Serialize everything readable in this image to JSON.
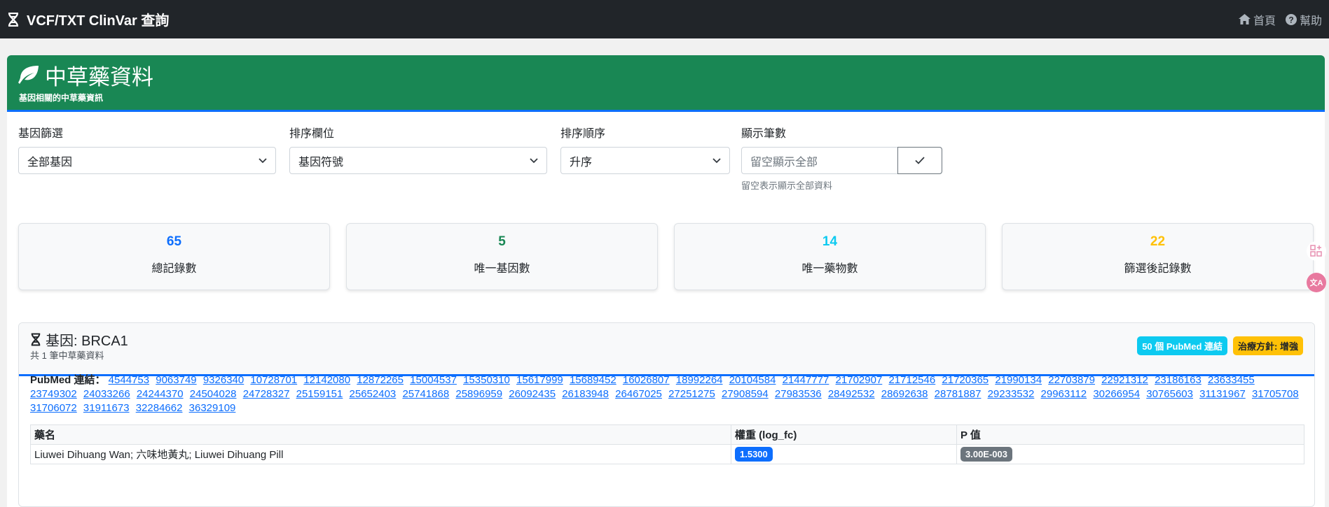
{
  "navbar": {
    "title": "VCF/TXT ClinVar 查詢",
    "home": "首頁",
    "help": "幫助"
  },
  "header": {
    "title": "中草藥資料",
    "subtitle": "基因相關的中草藥資訊"
  },
  "filters": {
    "gene_label": "基因篩選",
    "gene_value": "全部基因",
    "sort_field_label": "排序欄位",
    "sort_field_value": "基因符號",
    "sort_order_label": "排序順序",
    "sort_order_value": "升序",
    "count_label": "顯示筆數",
    "count_placeholder": "留空顯示全部",
    "count_help": "留空表示顯示全部資料"
  },
  "stats": [
    {
      "value": "65",
      "label": "總記錄數",
      "color": "#0d6efd"
    },
    {
      "value": "5",
      "label": "唯一基因數",
      "color": "#198754"
    },
    {
      "value": "14",
      "label": "唯一藥物數",
      "color": "#0dcaf0"
    },
    {
      "value": "22",
      "label": "篩選後記錄數",
      "color": "#ffc107"
    }
  ],
  "gene": {
    "title": "基因: BRCA1",
    "count": "共 1 筆中草藥資料",
    "badge_pubmed": "50 個 PubMed 連結",
    "badge_policy": "治療方針: 增強",
    "pubmed_label": "PubMed 連結：",
    "pubmed_ids": [
      "4544753",
      "9063749",
      "9326340",
      "10728701",
      "12142080",
      "12872265",
      "15004537",
      "15350310",
      "15617999",
      "15689452",
      "16026807",
      "18992264",
      "20104584",
      "21447777",
      "21702907",
      "21712546",
      "21720365",
      "21990134",
      "22703879",
      "22921312",
      "23186163",
      "23633455",
      "23749302",
      "24033266",
      "24244370",
      "24504028",
      "24728327",
      "25159151",
      "25652403",
      "25741868",
      "25896959",
      "26092435",
      "26183948",
      "26467025",
      "27251275",
      "27908594",
      "27983536",
      "28492532",
      "28692638",
      "28781887",
      "29233532",
      "29963112",
      "30266954",
      "30765603",
      "31131967",
      "31705708",
      "31706072",
      "31911673",
      "32284662",
      "36329109"
    ],
    "table": {
      "headers": [
        "藥名",
        "權重 (log_fc)",
        "P 值"
      ],
      "rows": [
        {
          "name": "Liuwei Dihuang Wan; 六味地黃丸; Liuwei Dihuang Pill",
          "weight": "1.5300",
          "p": "3.00E-003"
        }
      ]
    }
  }
}
